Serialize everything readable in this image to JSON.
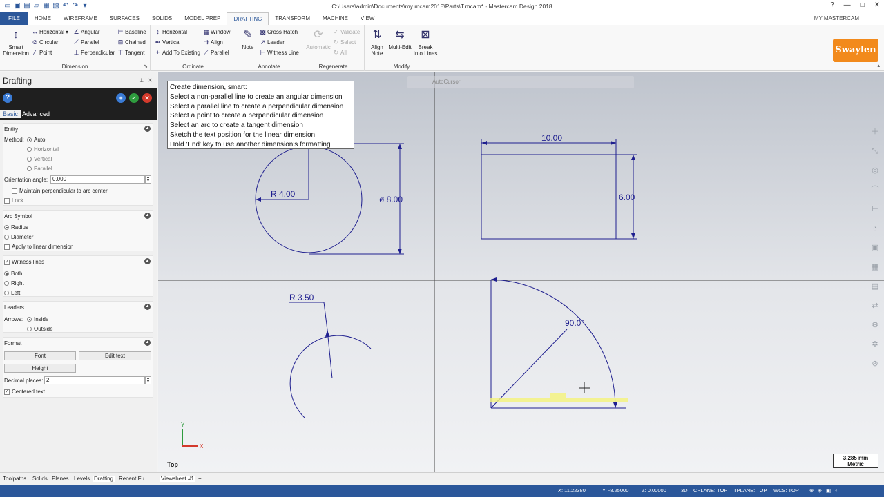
{
  "window": {
    "title": "C:\\Users\\admin\\Documents\\my mcam2018\\Parts\\T.mcam* - Mastercam Design 2018"
  },
  "tabs": [
    "FILE",
    "HOME",
    "WIREFRAME",
    "SURFACES",
    "SOLIDS",
    "MODEL PREP",
    "DRAFTING",
    "TRANSFORM",
    "MACHINE",
    "VIEW"
  ],
  "tab_active": "DRAFTING",
  "account_label": "MY MASTERCAM",
  "ribbon": {
    "dimension": {
      "label": "Dimension",
      "smart_line1": "Smart",
      "smart_line2": "Dimension",
      "horizontal": "Horizontal",
      "circular": "Circular",
      "point": "Point",
      "angular": "Angular",
      "parallel": "Parallel",
      "perpendicular": "Perpendicular",
      "baseline": "Baseline",
      "chained": "Chained",
      "tangent": "Tangent"
    },
    "ordinate": {
      "label": "Ordinate",
      "horizontal": "Horizontal",
      "vertical": "Vertical",
      "add_to_existing": "Add To Existing",
      "window": "Window",
      "align": "Align",
      "parallel": "Parallel"
    },
    "annotate": {
      "label": "Annotate",
      "note": "Note",
      "cross_hatch": "Cross Hatch",
      "leader": "Leader",
      "witness_line": "Witness Line"
    },
    "regenerate": {
      "label": "Regenerate",
      "automatic": "Automatic",
      "validate": "Validate",
      "select": "Select",
      "all": "All"
    },
    "modify": {
      "label": "Modify",
      "align_note_1": "Align",
      "align_note_2": "Note",
      "multi_edit": "Multi-Edit",
      "break_1": "Break",
      "break_2": "Into Lines"
    },
    "logo_text": "Swaylen"
  },
  "panel": {
    "title": "Drafting",
    "tab_basic": "Basic",
    "tab_advanced": "Advanced",
    "entity": {
      "header": "Entity",
      "method_label": "Method:",
      "auto": "Auto",
      "horizontal": "Horizontal",
      "vertical": "Vertical",
      "parallel": "Parallel",
      "orientation_label": "Orientation angle:",
      "orientation_value": "0.000",
      "maintain_perp": "Maintain perpendicular to arc center",
      "lock": "Lock"
    },
    "arc_symbol": {
      "header": "Arc Symbol",
      "radius": "Radius",
      "diameter": "Diameter",
      "apply_linear": "Apply to linear dimension"
    },
    "witness": {
      "header": "Witness lines",
      "both": "Both",
      "right": "Right",
      "left": "Left"
    },
    "leaders": {
      "header": "Leaders",
      "arrows_label": "Arrows:",
      "inside": "Inside",
      "outside": "Outside"
    },
    "format": {
      "header": "Format",
      "font": "Font",
      "edit_text": "Edit text",
      "height": "Height",
      "decimal_label": "Decimal places:",
      "decimal_value": "2",
      "centered_text": "Centered text"
    }
  },
  "viewport": {
    "tooltip": [
      "Create dimension, smart:",
      "Select a non-parallel line to create an angular dimension",
      "Select a parallel line to create a perpendicular dimension",
      "Select a point to create a perpendicular dimension",
      "Select an arc to create a tangent dimension",
      "Sketch the text position for the linear dimension",
      "Hold 'End' key to use another dimension's formatting"
    ],
    "autocursor": "AutoCursor",
    "dims": {
      "radius": "R 4.00",
      "diameter": "ø 8.00",
      "width": "10.00",
      "height": "6.00",
      "arc_radius": "R 3.50",
      "angle": "90.0°"
    },
    "axis_y": "Y",
    "axis_x": "X",
    "view_name": "Top",
    "scale_value": "3.285 mm",
    "scale_unit": "Metric"
  },
  "bottom_tabs": [
    "Toolpaths",
    "Solids",
    "Planes",
    "Levels",
    "Drafting",
    "Recent Fu..."
  ],
  "bottom_tab_active": "Drafting",
  "viewsheet": "Viewsheet #1",
  "viewsheet_add": "+",
  "status": {
    "x": "X:   11.22380",
    "y": "Y:   -8.25000",
    "z": "Z:   0.00000",
    "mode": "3D",
    "cplane": "CPLANE: TOP",
    "tplane": "TPLANE: TOP",
    "wcs": "WCS: TOP"
  },
  "colors": {
    "accent": "#2b579a",
    "geometry": "#1f1f8f",
    "logo": "#f28a1c"
  }
}
